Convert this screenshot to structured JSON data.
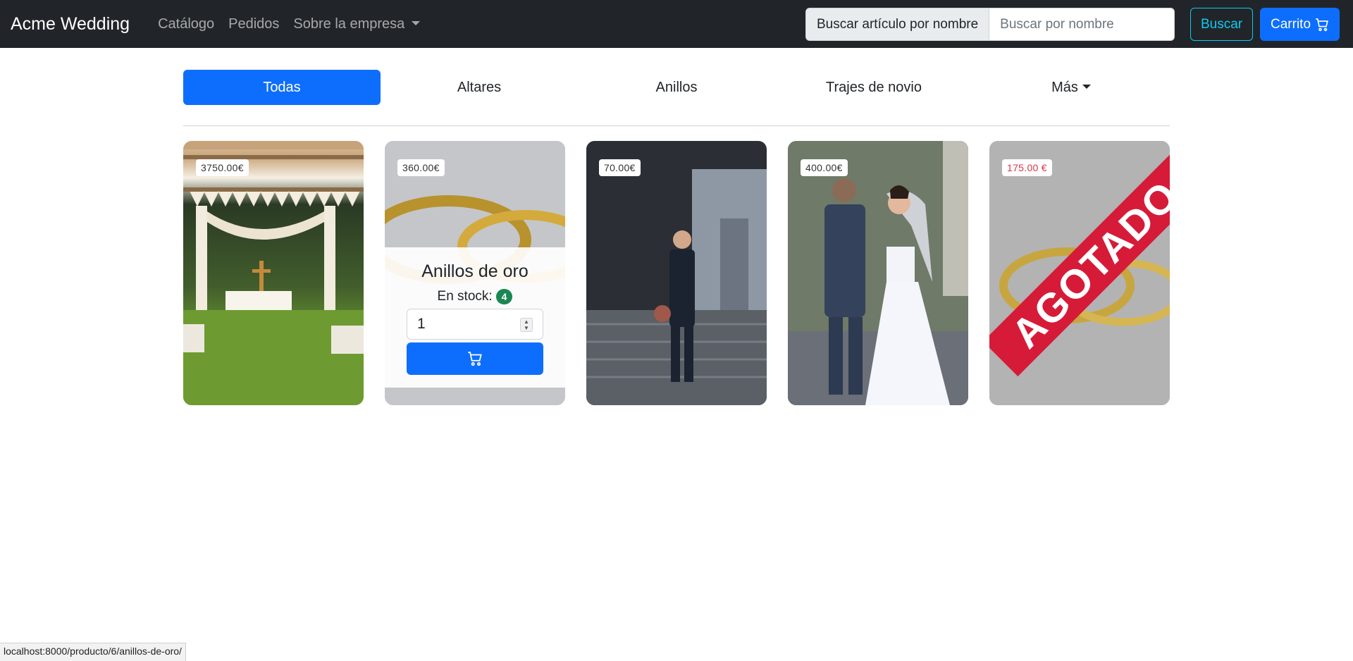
{
  "navbar": {
    "brand": "Acme Wedding",
    "links": [
      "Catálogo",
      "Pedidos",
      "Sobre la empresa"
    ],
    "search_prefix": "Buscar artículo por nombre",
    "search_placeholder": "Buscar por nombre",
    "search_button": "Buscar",
    "cart_button": "Carrito",
    "cart_icon": "cart-icon"
  },
  "tabs": [
    "Todas",
    "Altares",
    "Anillos",
    "Trajes de novio",
    "Más"
  ],
  "products": [
    {
      "price": "3750.00€"
    },
    {
      "price": "360.00€",
      "name": "Anillos de oro",
      "stock_label": "En stock:",
      "stock": "4",
      "quantity": "1"
    },
    {
      "price": "70.00€"
    },
    {
      "price": "400.00€"
    },
    {
      "price": "175.00 €",
      "banner": "AGOTADO"
    }
  ],
  "status_url": "localhost:8000/producto/6/anillos-de-oro/",
  "colors": {
    "navbar": "#212529",
    "primary": "#0d6efd",
    "info": "#0dcaf0",
    "success": "#198754",
    "sold_out": "#d61b38"
  }
}
